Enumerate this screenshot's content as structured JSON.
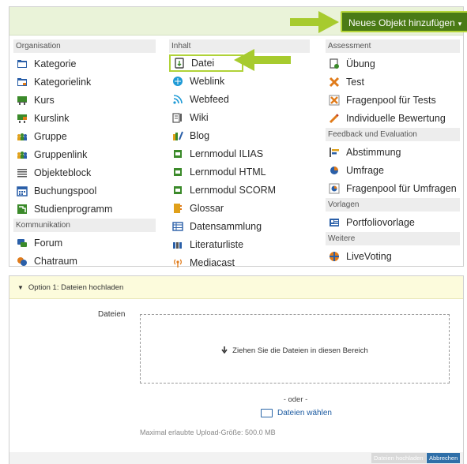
{
  "toolbar": {
    "add_button": "Neues Objekt hinzufügen",
    "caret": "▾"
  },
  "groups": {
    "organisation": {
      "header": "Organisation",
      "items": [
        "Kategorie",
        "Kategorielink",
        "Kurs",
        "Kurslink",
        "Gruppe",
        "Gruppenlink",
        "Objekteblock",
        "Buchungspool",
        "Studienprogramm"
      ]
    },
    "kommunikation": {
      "header": "Kommunikation",
      "items": [
        "Forum",
        "Chatraum"
      ]
    },
    "inhalt": {
      "header": "Inhalt",
      "items": [
        "Datei",
        "Weblink",
        "Webfeed",
        "Wiki",
        "Blog",
        "Lernmodul ILIAS",
        "Lernmodul HTML",
        "Lernmodul SCORM",
        "Glossar",
        "Datensammlung",
        "Literaturliste",
        "Mediacast"
      ]
    },
    "assessment": {
      "header": "Assessment",
      "items": [
        "Übung",
        "Test",
        "Fragenpool für Tests",
        "Individuelle Bewertung"
      ]
    },
    "feedback": {
      "header": "Feedback und Evaluation",
      "items": [
        "Abstimmung",
        "Umfrage",
        "Fragenpool für Umfragen"
      ]
    },
    "vorlagen": {
      "header": "Vorlagen",
      "items": [
        "Portfoliovorlage"
      ]
    },
    "weitere": {
      "header": "Weitere",
      "items": [
        "LiveVoting"
      ]
    }
  },
  "upload": {
    "section_title": "Option 1: Dateien hochladen",
    "field_label": "Dateien",
    "dropzone_text": "Ziehen Sie die Dateien in diesen Bereich",
    "oder": "- oder -",
    "choose_files": "Dateien wählen",
    "max_size": "Maximal erlaubte Upload-Größe: 500.0 MB",
    "upload_button": "Dateien hochladen",
    "cancel_button": "Abbrechen"
  },
  "colors": {
    "accent_green": "#4a7a16",
    "highlight": "#b0d238",
    "link_blue": "#1b5aa0",
    "primary_blue": "#2f6fa8"
  }
}
